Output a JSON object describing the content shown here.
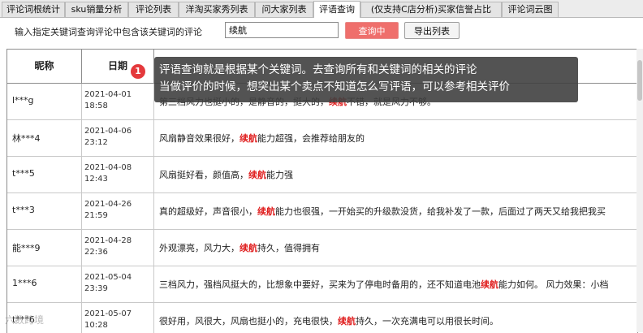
{
  "tabs": [
    {
      "label": "评论词根统计",
      "active": false
    },
    {
      "label": "sku销量分析",
      "active": false
    },
    {
      "label": "评论列表",
      "active": false
    },
    {
      "label": "洋淘买家秀列表",
      "active": false
    },
    {
      "label": "问大家列表",
      "active": false
    },
    {
      "label": "评语查询",
      "active": true
    },
    {
      "label": "(仅支持C店分析)买家信誉占比",
      "active": false
    },
    {
      "label": "评论词云图",
      "active": false
    }
  ],
  "query": {
    "label": "输入指定关键词查询评论中包含该关键词的评论",
    "value": "续航",
    "search_button": "查询中",
    "export_button": "导出列表"
  },
  "table": {
    "headers": {
      "nickname": "昵称",
      "date": "日期",
      "comment": ""
    },
    "keyword": "续航",
    "rows": [
      {
        "nickname": "l***g",
        "date": "2021-04-01",
        "time": "18:58",
        "comment": [
          "第三档风力也挺小的，是静音的，挺大的，",
          "续航",
          "不错，就是风力不够。"
        ]
      },
      {
        "nickname": "林***4",
        "date": "2021-04-06",
        "time": "23:12",
        "comment": [
          "风扇静音效果很好，",
          "续航",
          "能力超强，会推荐给朋友的"
        ]
      },
      {
        "nickname": "t***5",
        "date": "2021-04-08",
        "time": "12:43",
        "comment": [
          "风扇挺好看，颜值高，",
          "续航",
          "能力强"
        ]
      },
      {
        "nickname": "t***3",
        "date": "2021-04-26",
        "time": "21:59",
        "comment": [
          "真的超级好，声音很小，",
          "续航",
          "能力也很强，一开始买的升级款没货，给我补发了一款，后面过了两天又给我把我买"
        ]
      },
      {
        "nickname": "能***9",
        "date": "2021-04-28",
        "time": "22:36",
        "comment": [
          "外观漂亮，风力大，",
          "续航",
          "持久，值得拥有"
        ]
      },
      {
        "nickname": "1***6",
        "date": "2021-05-04",
        "time": "23:39",
        "comment": [
          "三档风力，强档风挺大的，比想象中要好，买来为了停电时备用的，还不知道电池",
          "续航",
          "能力如何。 风力效果：小档"
        ]
      },
      {
        "nickname": "t***6",
        "date": "2021-05-07",
        "time": "10:28",
        "comment": [
          "很好用，风很大，风扇也挺小的，充电很快，",
          "续航",
          "持久，一次充满电可以用很长时间。"
        ]
      }
    ]
  },
  "tooltip": {
    "badge": "1",
    "line1": "评语查询就是根据某个关键词。去查询所有和关键词的相关的评论",
    "line2": "当做评价的时候，想突出某个卖点不知道怎么写评语，可以参考相关评价"
  },
  "watermark": "六数跨境"
}
